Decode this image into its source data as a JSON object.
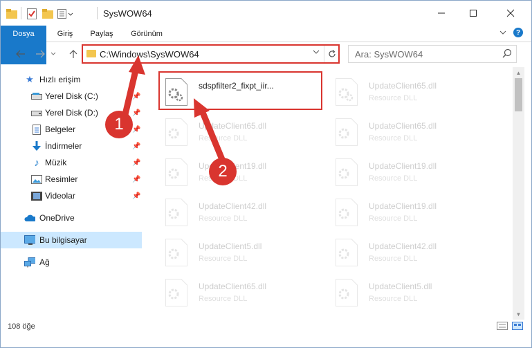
{
  "window": {
    "title": "SysWOW64",
    "controls": [
      "minimize-icon",
      "maximize-icon",
      "close-icon"
    ]
  },
  "ribbon": {
    "tabs": [
      "Dosya",
      "Giriş",
      "Paylaş",
      "Görünüm"
    ],
    "accent": "#1979ca"
  },
  "address": {
    "path": "C:\\Windows\\SysWOW64",
    "search_placeholder": "Ara: SysWOW64"
  },
  "sidebar": {
    "items": [
      {
        "label": "Hızlı erişim",
        "icon": "star-icon"
      },
      {
        "label": "Yerel Disk (C:)",
        "icon": "drive-icon",
        "pinned": true
      },
      {
        "label": "Yerel Disk (D:)",
        "icon": "drive-icon",
        "pinned": true
      },
      {
        "label": "Belgeler",
        "icon": "documents-icon",
        "pinned": true
      },
      {
        "label": "İndirmeler",
        "icon": "downloads-icon",
        "pinned": true
      },
      {
        "label": "Müzik",
        "icon": "music-icon",
        "pinned": true
      },
      {
        "label": "Resimler",
        "icon": "pictures-icon",
        "pinned": true
      },
      {
        "label": "Videolar",
        "icon": "videos-icon",
        "pinned": true
      },
      {
        "label": "OneDrive",
        "icon": "onedrive-icon"
      },
      {
        "label": "Bu bilgisayar",
        "icon": "computer-icon",
        "selected": true
      },
      {
        "label": "Ağ",
        "icon": "network-icon"
      }
    ]
  },
  "files": {
    "highlighted": {
      "name": "sdspfilter2_fixpt_iir...",
      "type": ""
    },
    "faded": [
      {
        "name": "UpdateClient65.dll",
        "type": "Resource DLL"
      },
      {
        "name": "UpdateClient65.dll",
        "type": "Resource DLL"
      },
      {
        "name": "UpdateClient65.dll",
        "type": "Resource DLL"
      },
      {
        "name": "UpdateClient19.dll",
        "type": "Resource DLL"
      },
      {
        "name": "UpdateClient19.dll",
        "type": "Resource DLL"
      },
      {
        "name": "UpdateClient42.dll",
        "type": "Resource DLL"
      },
      {
        "name": "UpdateClient19.dll",
        "type": "Resource DLL"
      },
      {
        "name": "UpdateClient5.dll",
        "type": "Resource DLL"
      },
      {
        "name": "UpdateClient42.dll",
        "type": "Resource DLL"
      },
      {
        "name": "UpdateClient65.dll",
        "type": "Resource DLL"
      },
      {
        "name": "UpdateClient5.dll",
        "type": "Resource DLL"
      }
    ]
  },
  "annotations": {
    "badge1": "1",
    "badge2": "2",
    "color": "#d9352f"
  },
  "status": {
    "count": "108 öğe"
  }
}
